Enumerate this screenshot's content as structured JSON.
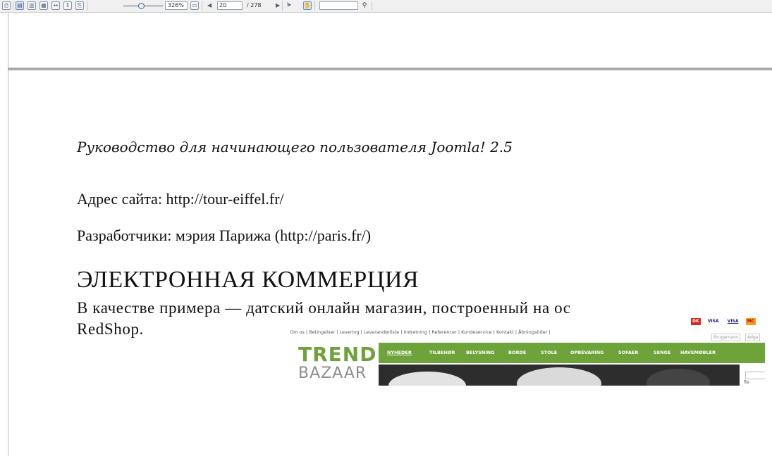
{
  "toolbar": {
    "buttons": [
      {
        "name": "print-icon",
        "glyph": "⎙"
      },
      {
        "name": "single-page-icon",
        "glyph": "▤"
      },
      {
        "name": "two-page-icon",
        "glyph": "▥"
      },
      {
        "name": "grid-view-icon",
        "glyph": "▦"
      },
      {
        "name": "fit-width-icon",
        "glyph": "↔"
      },
      {
        "name": "fit-height-icon",
        "glyph": "↕"
      },
      {
        "name": "save-icon",
        "glyph": "⎘"
      }
    ],
    "zoom_value": "326%",
    "zoom_slider_level": 0.4,
    "page_number": "20",
    "page_total": "/ 278",
    "search_placeholder": ""
  },
  "document": {
    "title": "Руководство для начинающего пользователя Joomla! 2.5",
    "line_1": "Адрес сайта: http://tour-eiffel.fr/",
    "line_2": "Разработчики: мэрия Парижа (http://paris.fr/)",
    "heading": "ЭЛЕКТРОННАЯ КОММЕРЦИЯ",
    "paragraph_line_1": "В качестве примера — датский онлайн магазин, построенный на ос",
    "paragraph_line_2": "RedShop."
  },
  "shop": {
    "top_links": "Om os | Betingelser | Levering | Leverandørliste | Indretning | Referencer | Kundeservice | Kontakt | Åbningstider |",
    "pay_logos": [
      "DK",
      "VISA",
      "VISA",
      "MC"
    ],
    "login_placeholders": [
      "Brugernavn",
      "Adga"
    ],
    "logo_top": "TREND",
    "logo_bottom": "BAZAAR",
    "nav": [
      "NYHEDER",
      "TILBEHØR",
      "BELYSNING",
      "BORDE",
      "STOLE",
      "OPBEVARING",
      "SOFAER",
      "SENGE",
      "HAVEMØBLER"
    ],
    "side_text": "fle"
  }
}
